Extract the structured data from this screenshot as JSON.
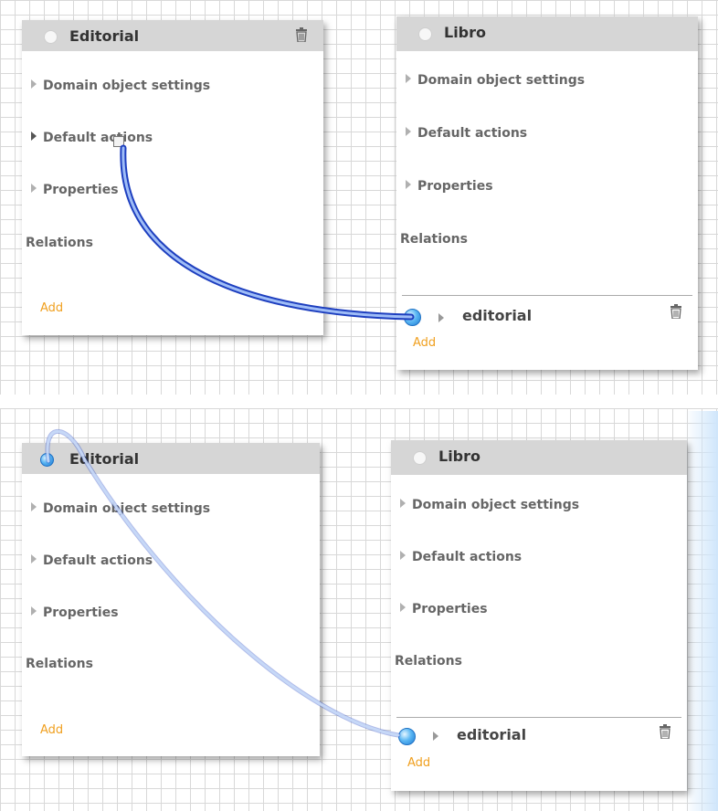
{
  "top_scene": {
    "source_entity": {
      "title": "Editorial",
      "sections": [
        "Domain object settings",
        "Default actions",
        "Properties"
      ],
      "relations_label": "Relations",
      "add_label": "Add"
    },
    "target_entity": {
      "title": "Libro",
      "sections": [
        "Domain object settings",
        "Default actions",
        "Properties"
      ],
      "relations_label": "Relations",
      "relation_name": "editorial",
      "add_label": "Add"
    }
  },
  "bottom_scene": {
    "source_entity": {
      "title": "Editorial",
      "sections": [
        "Domain object settings",
        "Default actions",
        "Properties"
      ],
      "relations_label": "Relations",
      "add_label": "Add"
    },
    "target_entity": {
      "title": "Libro",
      "sections": [
        "Domain object settings",
        "Default actions",
        "Properties"
      ],
      "relations_label": "Relations",
      "relation_name": "editorial",
      "add_label": "Add"
    }
  },
  "icons": {
    "collapse_arrow": "triangle-right",
    "delete": "trash-icon",
    "connection_port": "blue-circle"
  },
  "colors": {
    "header_bg": "#d6d6d6",
    "add_link": "#f0a020",
    "wire_blue": "#2f57d8",
    "port_blue": "#5cb8f4",
    "grid": "#d8d8d8"
  }
}
